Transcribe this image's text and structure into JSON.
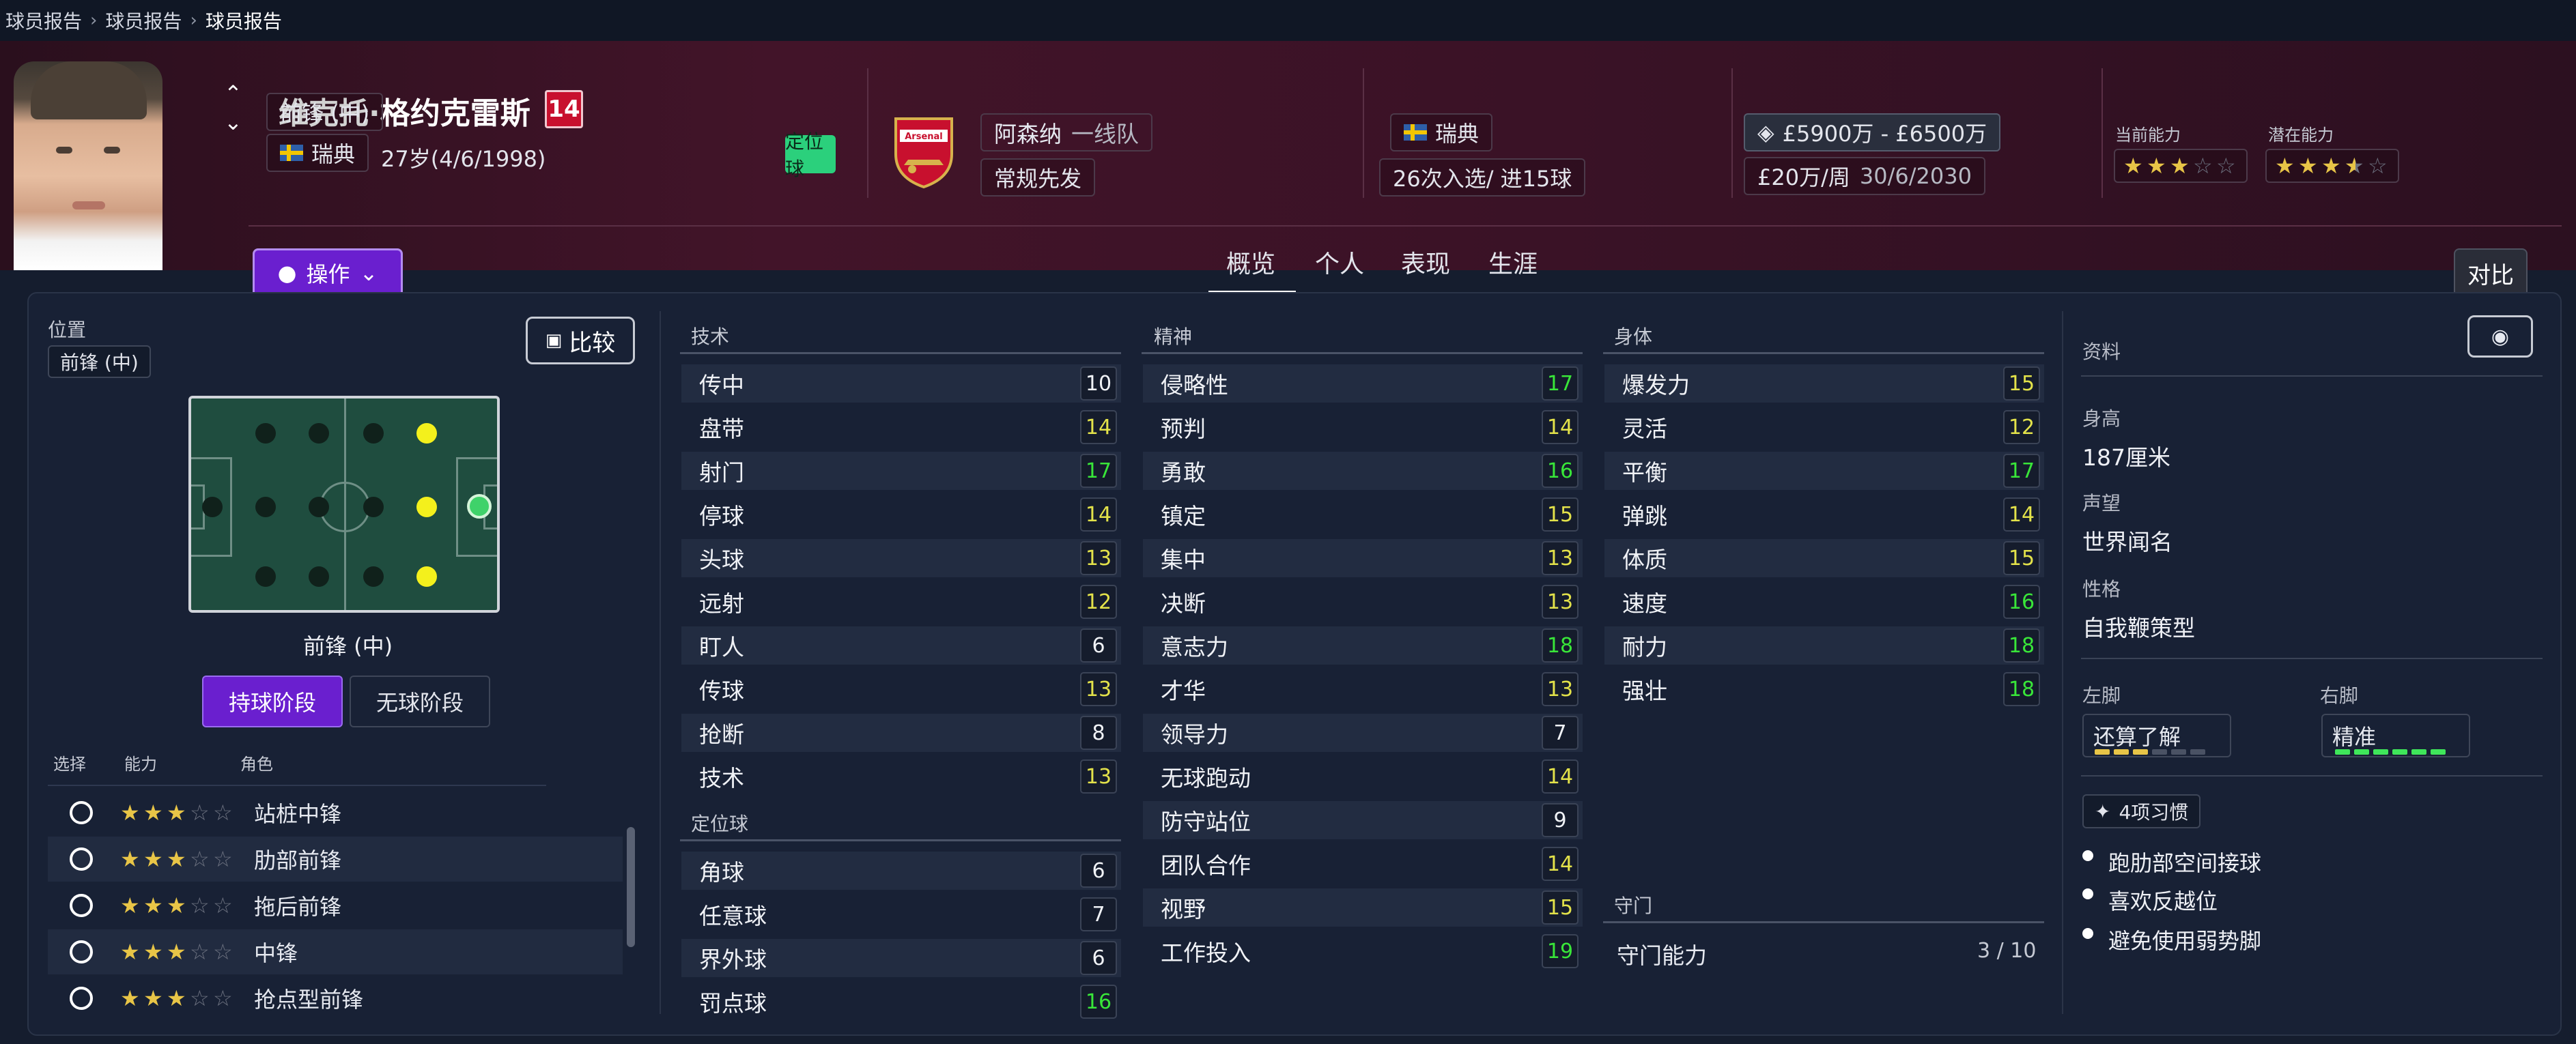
{
  "breadcrumb": [
    "球员报告",
    "球员报告",
    "球员报告"
  ],
  "header": {
    "name": "维克托·格约克雷斯",
    "number": "14",
    "position": "前锋 (中)",
    "nation": "瑞典",
    "age": "27岁(4/6/1998)",
    "action_label": "操作",
    "setpiece_badge": "定位球",
    "club_name": "阿森纳",
    "club_team": "一线队",
    "crest_text": "Arsenal",
    "squad_status": "常规先发",
    "nation2": "瑞典",
    "caps": "26次入选/ 进15球",
    "value": "£5900万 - £6500万",
    "wage": "£20万/周",
    "contract": "30/6/2030",
    "ca_label": "当前能力",
    "pa_label": "潜在能力",
    "ca_stars": 3,
    "pa_stars": 3.5,
    "compare_label": "对比"
  },
  "tabs": [
    "概览",
    "个人",
    "表现",
    "生涯"
  ],
  "left": {
    "position_label": "位置",
    "position_value": "前锋 (中)",
    "compare_btn": "比较",
    "field_caption": "前锋 (中)",
    "phase_in": "持球阶段",
    "phase_out": "无球阶段",
    "col_select": "选择",
    "col_ability": "能力",
    "col_role": "角色",
    "roles": [
      {
        "name": "站桩中锋",
        "stars": 3
      },
      {
        "name": "肋部前锋",
        "stars": 3
      },
      {
        "name": "拖后前锋",
        "stars": 3
      },
      {
        "name": "中锋",
        "stars": 3
      },
      {
        "name": "抢点型前锋",
        "stars": 3
      }
    ]
  },
  "technical": {
    "title": "技术",
    "items": [
      {
        "name": "传中",
        "value": 10
      },
      {
        "name": "盘带",
        "value": 14
      },
      {
        "name": "射门",
        "value": 17
      },
      {
        "name": "停球",
        "value": 14
      },
      {
        "name": "头球",
        "value": 13
      },
      {
        "name": "远射",
        "value": 12
      },
      {
        "name": "盯人",
        "value": 6
      },
      {
        "name": "传球",
        "value": 13
      },
      {
        "name": "抢断",
        "value": 8
      },
      {
        "name": "技术",
        "value": 13
      }
    ]
  },
  "setpieces": {
    "title": "定位球",
    "items": [
      {
        "name": "角球",
        "value": 6
      },
      {
        "name": "任意球",
        "value": 7
      },
      {
        "name": "界外球",
        "value": 6
      },
      {
        "name": "罚点球",
        "value": 16
      }
    ]
  },
  "mental": {
    "title": "精神",
    "items": [
      {
        "name": "侵略性",
        "value": 17
      },
      {
        "name": "预判",
        "value": 14
      },
      {
        "name": "勇敢",
        "value": 16
      },
      {
        "name": "镇定",
        "value": 15
      },
      {
        "name": "集中",
        "value": 13
      },
      {
        "name": "决断",
        "value": 13
      },
      {
        "name": "意志力",
        "value": 18
      },
      {
        "name": "才华",
        "value": 13
      },
      {
        "name": "领导力",
        "value": 7
      },
      {
        "name": "无球跑动",
        "value": 14
      },
      {
        "name": "防守站位",
        "value": 9
      },
      {
        "name": "团队合作",
        "value": 14
      },
      {
        "name": "视野",
        "value": 15
      },
      {
        "name": "工作投入",
        "value": 19
      }
    ]
  },
  "physical": {
    "title": "身体",
    "items": [
      {
        "name": "爆发力",
        "value": 15
      },
      {
        "name": "灵活",
        "value": 12
      },
      {
        "name": "平衡",
        "value": 17
      },
      {
        "name": "弹跳",
        "value": 14
      },
      {
        "name": "体质",
        "value": 15
      },
      {
        "name": "速度",
        "value": 16
      },
      {
        "name": "耐力",
        "value": 18
      },
      {
        "name": "强壮",
        "value": 18
      }
    ]
  },
  "goalkeeping": {
    "title": "守门",
    "label": "守门能力",
    "value": "3 / 10"
  },
  "profile": {
    "title": "资料",
    "height_label": "身高",
    "height": "187厘米",
    "rep_label": "声望",
    "rep": "世界闻名",
    "personality_label": "性格",
    "personality": "自我鞭策型",
    "left_foot_label": "左脚",
    "left_foot": "还算了解",
    "left_foot_level": 3,
    "right_foot_label": "右脚",
    "right_foot": "精准",
    "right_foot_level": 6,
    "habits_label": "4项习惯",
    "habits": [
      "跑肋部空间接球",
      "喜欢反越位",
      "避免使用弱势脚"
    ]
  },
  "colors": {
    "accent_purple": "#6a1fcf",
    "header_bg": "#421429",
    "panel_bg": "#182135",
    "attr_high": "#39e639",
    "attr_mid": "#e3e24a"
  }
}
